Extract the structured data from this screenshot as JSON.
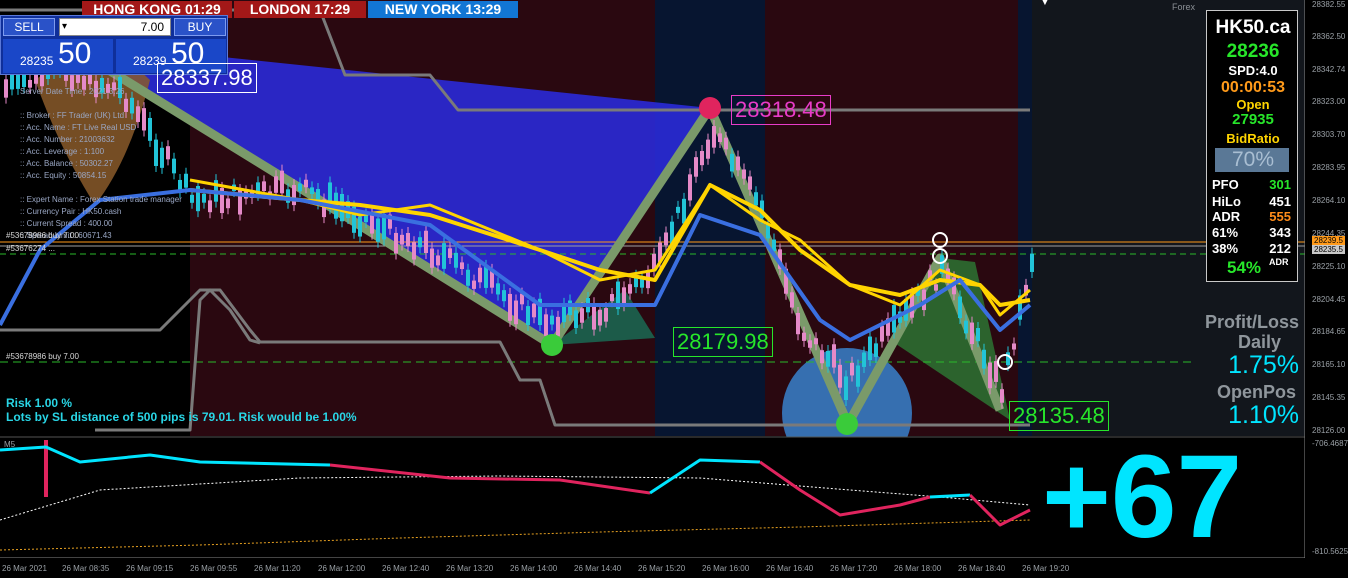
{
  "sessions": {
    "hong_kong": "HONG KONG 01:29",
    "london": "LONDON  17:29",
    "new_york": "NEW YORK 13:29"
  },
  "trade_panel": {
    "sell_label": "SELL",
    "buy_label": "BUY",
    "lot_value": "7.00",
    "sell_price_small": "28235",
    "sell_price_big": "50",
    "buy_price_small": "28239",
    "buy_price_big": "50"
  },
  "account_info": [
    "Server Date Time : 2021.3.26",
    "::  Broker          :  FF Trader (UK) Ltd",
    "::  Acc. Name       :  FT Live Real USD",
    "::  Acc. Number     :  21003632",
    "::  Acc. Leverage   :  1:100",
    "::  Acc. Balance    :  50302.27",
    "::  Acc. Equity     :  50854.15",
    "::  Expert Name     :  Forex Station trade manager",
    "::  Currency Pair   :  HK50.cash",
    "::  Current Spread  :  400.00",
    "::  Spread Limit    :  60671.43"
  ],
  "order_lines": {
    "line1": "#53678986 buy 7.00",
    "line2": "#53676274 ...",
    "line3": "#53678986 buy 7.00"
  },
  "price_labels": {
    "high_left": "28337.98",
    "peak": "28318.48",
    "mid_low": "28179.98",
    "low": "28135.48"
  },
  "risk": {
    "line1": "Risk 1.00 %",
    "line2": "Lots by SL distance of 500 pips is 79.01. Risk would be 1.00%"
  },
  "top_right_text": "Forex",
  "panel": {
    "symbol": "HK50.ca",
    "price": "28236",
    "spread": "SPD:4.0",
    "timer": "00:00:53",
    "open_label": "Open",
    "open_value": "27935",
    "bidratio_label": "BidRatio",
    "bidratio_value": "70%",
    "rows": [
      {
        "k": "PFO",
        "v": "301",
        "c": "#27e62a"
      },
      {
        "k": "HiLo",
        "v": "451",
        "c": "#ffffff"
      },
      {
        "k": "ADR",
        "v": "555",
        "c": "#ff8c1a"
      },
      {
        "k": "61%",
        "v": "343",
        "c": "#ffffff"
      },
      {
        "k": "38%",
        "v": "212",
        "c": "#ffffff"
      }
    ],
    "adr_pct": "54%",
    "adr_sub": "ADR"
  },
  "profit": {
    "daily_label1": "Profit/Loss",
    "daily_label2": "Daily",
    "daily_value": "1.75%",
    "openpos_label": "OpenPos",
    "openpos_value": "1.10%"
  },
  "big_score": "+67",
  "indicator_label": "M5",
  "price_axis": [
    "28382.55",
    "28362.50",
    "28342.74",
    "28323.00",
    "28303.70",
    "28283.95",
    "28264.10",
    "28244.35",
    "28225.10",
    "28204.45",
    "28184.65",
    "28165.10",
    "28145.35",
    "28126.00"
  ],
  "indicator_axis": [
    "-706.4687",
    "-810.5625"
  ],
  "time_axis": [
    "26 Mar 2021",
    "26 Mar 08:35",
    "26 Mar 09:15",
    "26 Mar 09:55",
    "26 Mar 11:20",
    "26 Mar 12:00",
    "26 Mar 12:40",
    "26 Mar 13:20",
    "26 Mar 14:00",
    "26 Mar 14:40",
    "26 Mar 15:20",
    "26 Mar 16:00",
    "26 Mar 16:40",
    "26 Mar 17:20",
    "26 Mar 18:00",
    "26 Mar 18:40",
    "26 Mar 19:20"
  ],
  "price_tags": [
    "28239.5",
    "28235.5"
  ],
  "colors": {
    "bg": "#000000",
    "session_red": "#2a0810",
    "session_blue": "#071530",
    "bull": "#22c4d8",
    "bear": "#e58ac8",
    "ma_yellow": "#ffd400",
    "ma_blue": "#3a6fe0",
    "zigzag": "#7a9a6a",
    "accent_cyan": "#00e5ff"
  }
}
